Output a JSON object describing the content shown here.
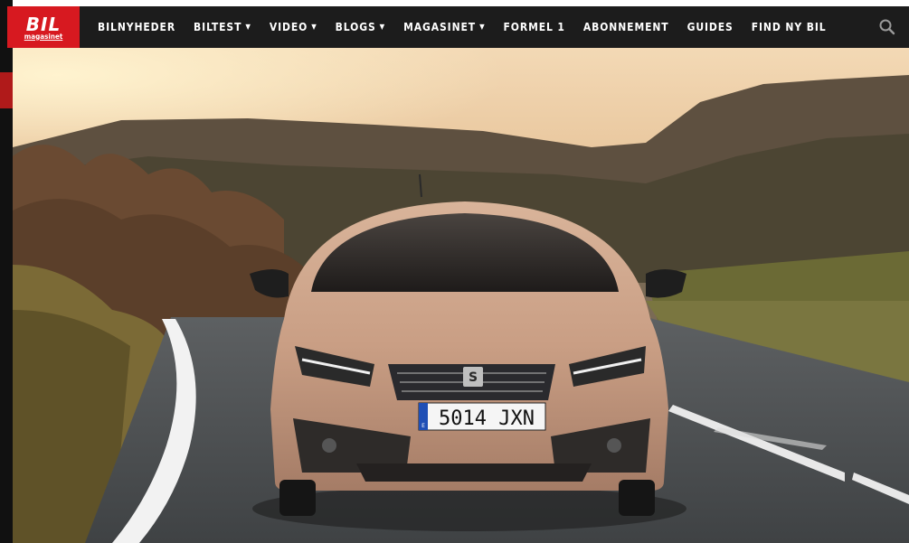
{
  "site": {
    "logo_text": "BIL",
    "logo_subtext": "magasinet"
  },
  "nav": {
    "items": [
      {
        "label": "BILNYHEDER",
        "dropdown": false
      },
      {
        "label": "BILTEST",
        "dropdown": true
      },
      {
        "label": "VIDEO",
        "dropdown": true
      },
      {
        "label": "BLOGS",
        "dropdown": true
      },
      {
        "label": "MAGASINET",
        "dropdown": true
      },
      {
        "label": "FORMEL 1",
        "dropdown": false
      },
      {
        "label": "ABONNEMENT",
        "dropdown": false
      },
      {
        "label": "GUIDES",
        "dropdown": false
      },
      {
        "label": "FIND NY BIL",
        "dropdown": false
      }
    ],
    "dropdown_glyph": "▼",
    "search_icon": "search-icon"
  },
  "hero": {
    "car_brand_badge": "S",
    "license_plate": "5014 JXN",
    "plate_country_code": "E"
  },
  "colors": {
    "nav_background": "#1c1c1c",
    "logo_red": "#d71920",
    "nav_text": "#ffffff"
  }
}
